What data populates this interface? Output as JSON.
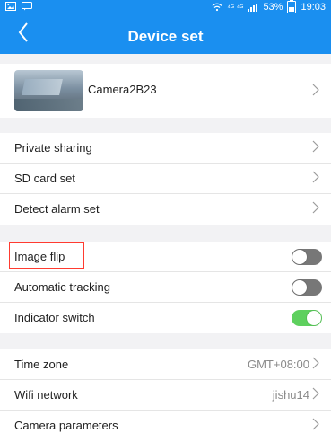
{
  "status_bar": {
    "network": "⁴ᴳ ⁴ᴳ",
    "battery_percent": "53%",
    "time": "19:03"
  },
  "header": {
    "title": "Device set"
  },
  "camera": {
    "name": "Camera2B23"
  },
  "rows": {
    "private_sharing": "Private sharing",
    "sd_card_set": "SD card set",
    "detect_alarm_set": "Detect alarm set",
    "image_flip": "Image flip",
    "automatic_tracking": "Automatic tracking",
    "indicator_switch": "Indicator switch",
    "time_zone": "Time zone",
    "time_zone_value": "GMT+08:00",
    "wifi_network": "Wifi network",
    "wifi_network_value": "jishu14",
    "camera_parameters": "Camera parameters"
  },
  "toggles": {
    "image_flip": false,
    "automatic_tracking": false,
    "indicator_switch": true
  },
  "colors": {
    "header": "#1a8ff0",
    "toggle_on": "#5ed05e",
    "toggle_off": "#777777",
    "highlight": "#ff3b30"
  },
  "icons": {
    "back": "chevron-left-icon",
    "chevron": "chevron-right-icon",
    "wifi": "wifi-icon",
    "battery": "battery-icon",
    "image": "image-icon",
    "message": "message-icon"
  }
}
